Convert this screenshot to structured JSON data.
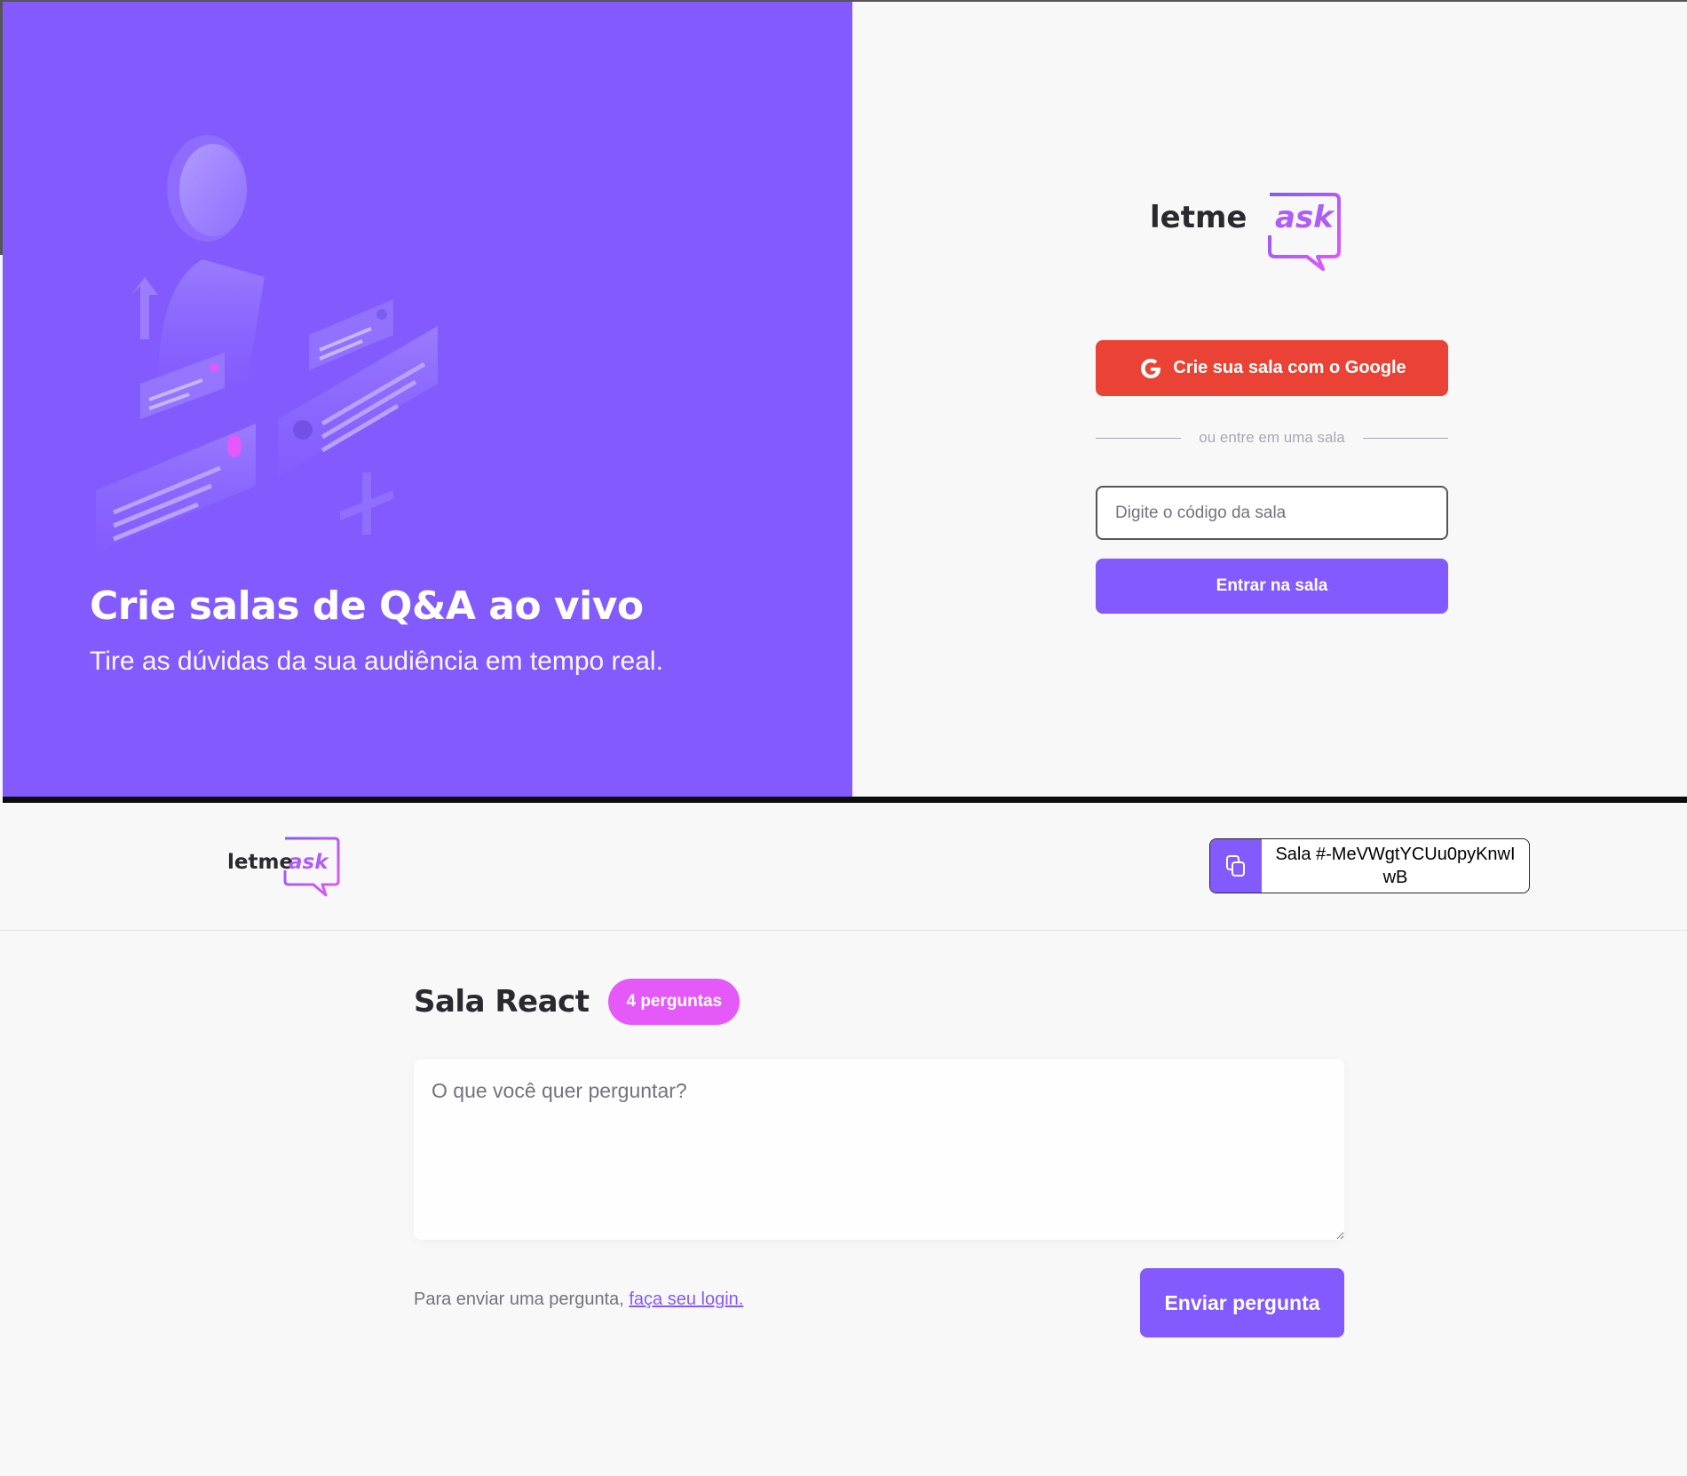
{
  "auth": {
    "aside": {
      "title": "Crie salas de Q&A ao vivo",
      "subtitle": "Tire as dúvidas da sua audiência em tempo real."
    },
    "logo": {
      "part1": "letme",
      "part2": "ask"
    },
    "google_button": "Crie sua sala com o Google",
    "separator": "ou entre em uma sala",
    "room_code_input": {
      "placeholder": "Digite o código da sala",
      "value": ""
    },
    "enter_button": "Entrar na sala"
  },
  "room": {
    "logo": {
      "part1": "letme",
      "part2": "ask"
    },
    "room_code": "Sala #-MeVWgtYCUu0pyKnwIwB",
    "title": "Sala React",
    "question_count": "4 perguntas",
    "question_input": {
      "placeholder": "O que você quer perguntar?",
      "value": ""
    },
    "login_note": "Para enviar uma pergunta,",
    "login_link": "faça seu login.",
    "send_button": "Enviar pergunta"
  },
  "colors": {
    "purple": "#835afd",
    "pink": "#e559f9",
    "google_red": "#ea4335",
    "background": "#f8f8f8",
    "text": "#29292e"
  },
  "icons": [
    "illustration-qa",
    "google-icon",
    "copy-icon",
    "logo-speech-bubble"
  ]
}
